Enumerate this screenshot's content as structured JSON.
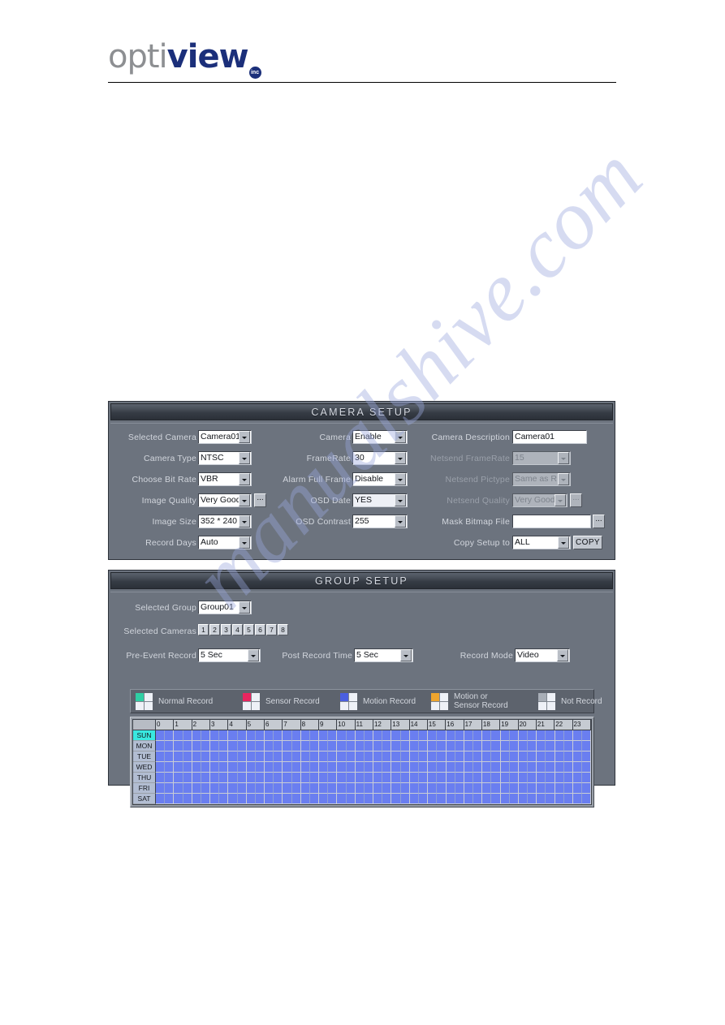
{
  "brand": {
    "logo_opti": "opti",
    "logo_view": "view",
    "logo_inc": "inc"
  },
  "watermark": {
    "text": "manualshive.com"
  },
  "camera_setup": {
    "title": "CAMERA SETUP",
    "fields": {
      "selected_camera": {
        "label": "Selected Camera",
        "value": "Camera01"
      },
      "camera_type": {
        "label": "Camera Type",
        "value": "NTSC"
      },
      "choose_bit_rate": {
        "label": "Choose Bit Rate",
        "value": "VBR"
      },
      "image_quality": {
        "label": "Image Quality",
        "value": "Very Good"
      },
      "image_size": {
        "label": "Image Size",
        "value": "352 * 240"
      },
      "record_days": {
        "label": "Record Days",
        "value": "Auto"
      },
      "camera": {
        "label": "Camera",
        "value": "Enable"
      },
      "frame_rate": {
        "label": "FrameRate",
        "value": "30"
      },
      "alarm_full_frame": {
        "label": "Alarm Full Frame",
        "value": "Disable"
      },
      "osd_date": {
        "label": "OSD Date",
        "value": "YES"
      },
      "osd_contrast": {
        "label": "OSD Contrast",
        "value": "255"
      },
      "camera_description": {
        "label": "Camera Description",
        "value": "Camera01"
      },
      "netsend_framerate": {
        "label": "Netsend FrameRate",
        "value": "15"
      },
      "netsend_pictype": {
        "label": "Netsend Pictype",
        "value": "Same as R"
      },
      "netsend_quality": {
        "label": "Netsend Quality",
        "value": "Very Good"
      },
      "mask_bitmap_file": {
        "label": "Mask Bitmap File",
        "value": ""
      },
      "copy_setup_to": {
        "label": "Copy Setup to",
        "value": "ALL"
      }
    },
    "copy_button": "COPY",
    "browse_button": "..."
  },
  "group_setup": {
    "title": "GROUP SETUP",
    "fields": {
      "selected_group": {
        "label": "Selected Group",
        "value": "Group01"
      },
      "selected_cameras": {
        "label": "Selected Cameras"
      },
      "pre_event_record": {
        "label": "Pre-Event Record",
        "value": "5 Sec"
      },
      "post_record_time": {
        "label": "Post Record Time",
        "value": "5 Sec"
      },
      "record_mode": {
        "label": "Record Mode",
        "value": "Video"
      }
    },
    "camera_buttons": [
      "1",
      "2",
      "3",
      "4",
      "5",
      "6",
      "7",
      "8"
    ],
    "legend": [
      {
        "label": "Normal Record",
        "color": "#2fcfa4"
      },
      {
        "label": "Sensor Record",
        "color": "#e8255f"
      },
      {
        "label": "Motion Record",
        "color": "#4a5fe0"
      },
      {
        "label": "Motion or\nSensor Record",
        "color": "#efa52e"
      },
      {
        "label": "Not Record",
        "color": "#a8aeb7"
      }
    ],
    "schedule": {
      "hours": [
        "0",
        "1",
        "2",
        "3",
        "4",
        "5",
        "6",
        "7",
        "8",
        "9",
        "10",
        "11",
        "12",
        "13",
        "14",
        "15",
        "16",
        "17",
        "18",
        "19",
        "20",
        "21",
        "22",
        "23"
      ],
      "days": [
        "SUN",
        "MON",
        "TUE",
        "WED",
        "THU",
        "FRI",
        "SAT"
      ],
      "selected_day": "SUN",
      "slot_color": "#6a7ef0",
      "all_slots_mode": "Motion Record"
    }
  }
}
